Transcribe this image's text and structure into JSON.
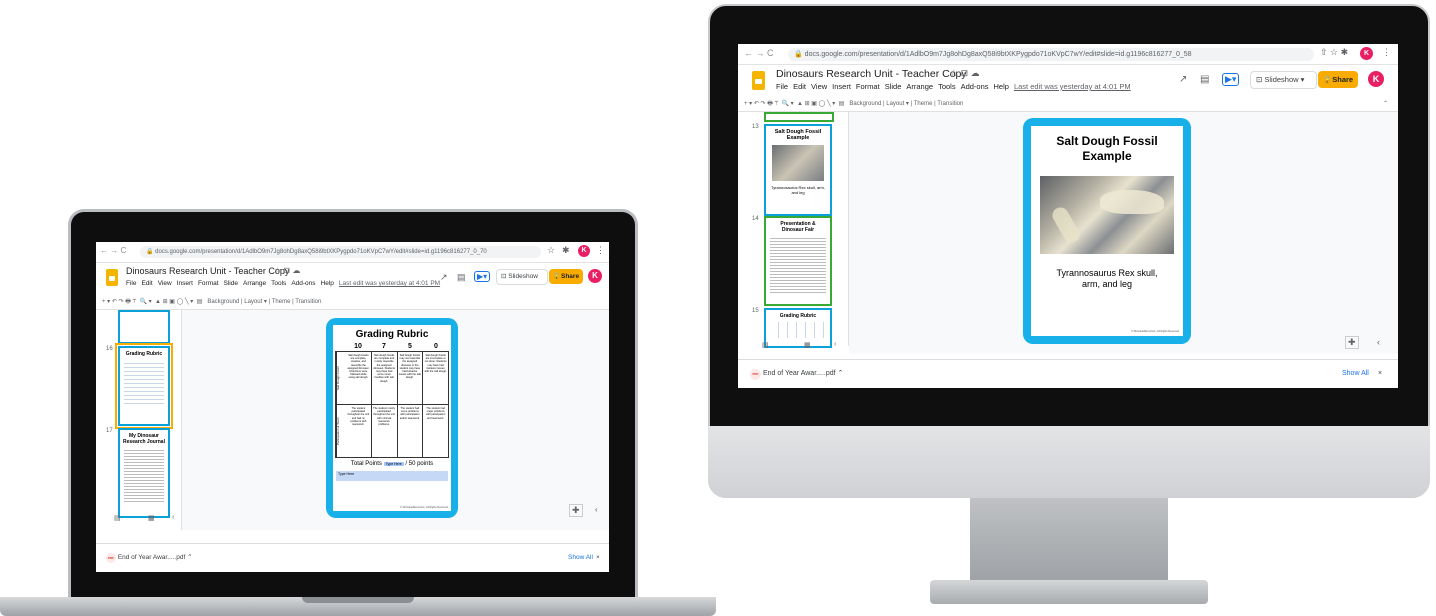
{
  "browser": {
    "nav_symbols": "← → C",
    "laptop_url": "docs.google.com/presentation/d/1AdlbO9m7Jg8ohDg8axQ58i9btXKPygpdo71oKVpC7wY/edit#slide=id.g1196c816277_0_70",
    "desktop_url": "docs.google.com/presentation/d/1AdlbO9m7Jg8ohDg8axQ58i9btXKPygpdo71oKVpC7wY/edit#slide=id.g1196c816277_0_58",
    "avatar_letter": "K",
    "lock_icon": "lock-icon"
  },
  "doc": {
    "title": "Dinosaurs Research Unit - Teacher Copy",
    "menus": [
      "File",
      "Edit",
      "View",
      "Insert",
      "Format",
      "Slide",
      "Arrange",
      "Tools",
      "Add-ons",
      "Help"
    ],
    "last_edit": "Last edit was yesterday at 4:01 PM",
    "slideshow_label": "Slideshow",
    "share_label": "Share"
  },
  "toolbar": {
    "background": "Background",
    "layout": "Layout ▾",
    "theme": "Theme",
    "transition": "Transition"
  },
  "laptop": {
    "thumb_numbers": [
      "16",
      "17"
    ],
    "thumb16_title": "Grading Rubric",
    "thumb17_title": "My Dinosaur Research Journal",
    "slide": {
      "title": "Grading Rubric",
      "scores": [
        "10",
        "7",
        "5",
        "0"
      ],
      "row_labels": [
        "Salt Dough Fossil",
        "Participation & Team"
      ],
      "cells_row1": [
        "Salt dough fossils are complete, creative, and resemble the assigned dinosaur. Directions were followed while using salt dough.",
        "Salt dough fossils are complete and mostly resemble the assigned dinosaur. Students may have had some minor troubles with salt dough.",
        "Salt dough fossils may not resemble the assigned dinosaur or the student may have had behavior issues with the salt dough.",
        "Salt dough fossils are incomplete or not done. Students may have had behavior issues with the salt dough."
      ],
      "cells_row2": [
        "The student participated throughout the unit and had no problems with teamwork.",
        "The student mostly participated throughout the unit with minimal teamwork problems.",
        "The student had some problems with participation and/or teamwork.",
        "The student had major problems with participation and teamwork."
      ],
      "total_label": "Total Points",
      "type_here": "Type Here",
      "out_of": "/ 50 points",
      "comment_box": "Type Here",
      "copyright": "© 4thGradeMemorium, All Rights Reserved"
    }
  },
  "desktop": {
    "thumb_numbers": [
      "13",
      "14",
      "15"
    ],
    "thumb13_title": "Salt Dough Fossil Example",
    "thumb13_caption": "Tyrannosaurus Rex skull, arm, and leg",
    "thumb14_title": "Presentation & Dinosaur Fair",
    "thumb15_title": "Grading Rubric",
    "slide": {
      "title": "Salt Dough Fossil Example",
      "caption": "Tyrannosaurus Rex skull, arm, and leg",
      "copyright": "© 4thGradeMemorium, All Rights Reserved"
    }
  },
  "downloads": {
    "file": "End of Year Awar.....pdf",
    "show_all": "Show All",
    "close_symbol": "×",
    "pdf_label": "PDF"
  },
  "colors": {
    "slide_border": "#18b0e8",
    "share_button": "#f9ab00",
    "avatar": "#e91e63"
  }
}
